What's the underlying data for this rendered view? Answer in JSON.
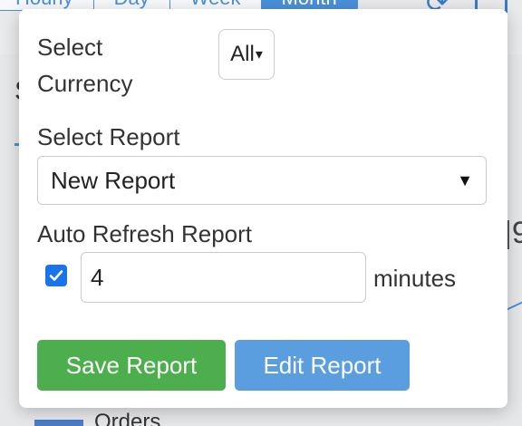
{
  "background": {
    "tabs": [
      {
        "label": "Hourly"
      },
      {
        "label": "Day"
      },
      {
        "label": "Week"
      },
      {
        "label": "Month"
      }
    ],
    "active_tab": "Month",
    "legend_label": "Orders"
  },
  "popup": {
    "currency": {
      "label_line1": "Select",
      "label_line2": "Currency",
      "value": "All",
      "caret": "▾"
    },
    "report": {
      "label": "Select Report",
      "value": "New Report",
      "caret": "▼"
    },
    "auto_refresh": {
      "label": "Auto Refresh Report",
      "checked": true,
      "value": "4",
      "unit": "minutes"
    },
    "buttons": {
      "save": "Save Report",
      "edit": "Edit Report"
    }
  },
  "colors": {
    "accent": "#4a90d9",
    "save_button": "#4cae4c",
    "edit_button": "#5b9ee0",
    "checkbox": "#1a73e8"
  }
}
